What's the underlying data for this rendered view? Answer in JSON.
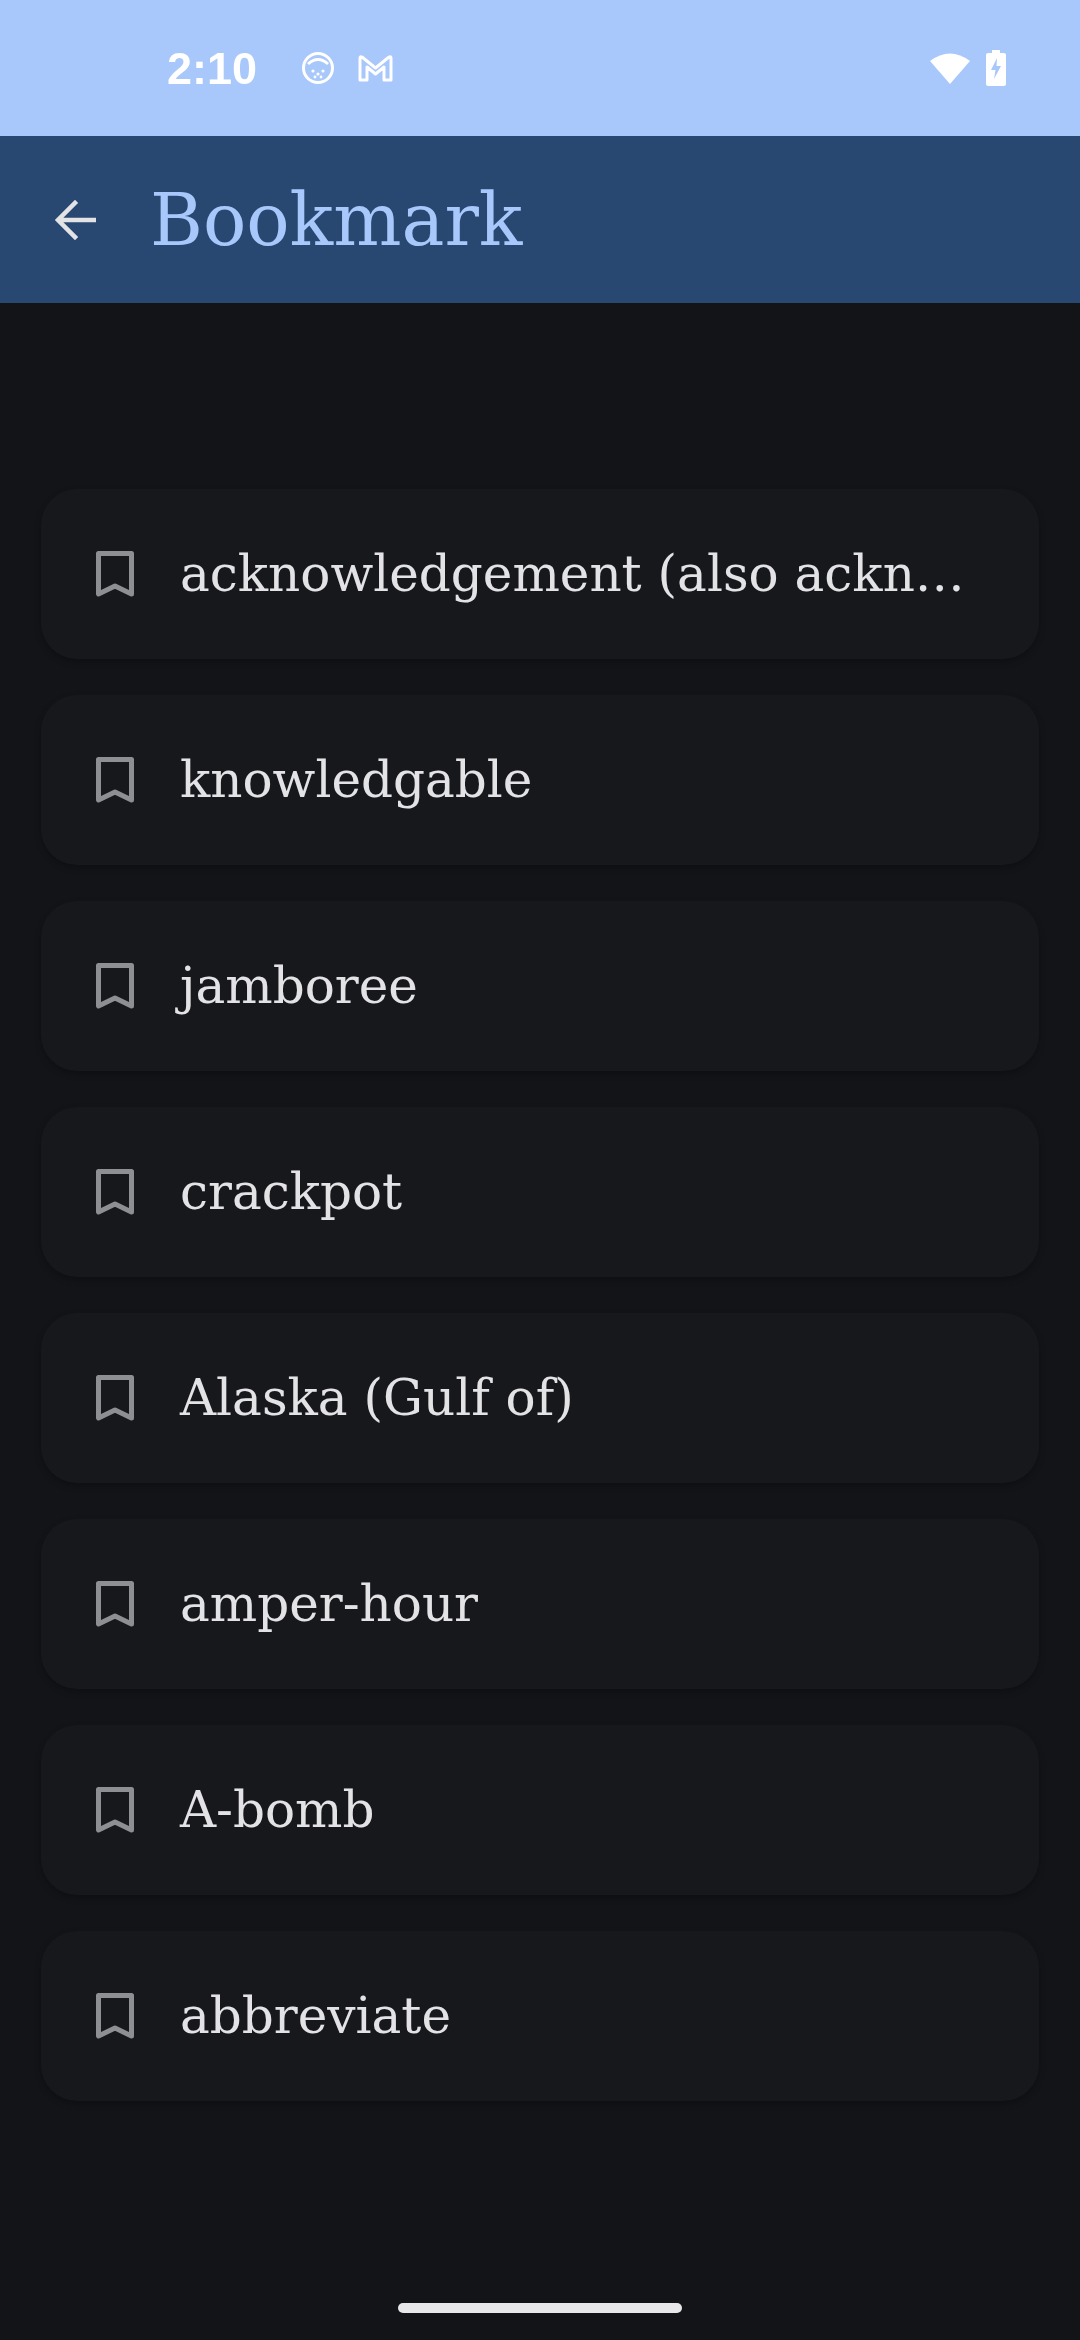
{
  "status_bar": {
    "time": "2:10"
  },
  "app_bar": {
    "title": "Bookmark"
  },
  "bookmarks": [
    {
      "word": "acknowledgement (also ackn…"
    },
    {
      "word": "knowledgable"
    },
    {
      "word": "jamboree"
    },
    {
      "word": "crackpot"
    },
    {
      "word": "Alaska (Gulf of)"
    },
    {
      "word": "amper-hour"
    },
    {
      "word": "A-bomb"
    },
    {
      "word": "abbreviate"
    }
  ]
}
